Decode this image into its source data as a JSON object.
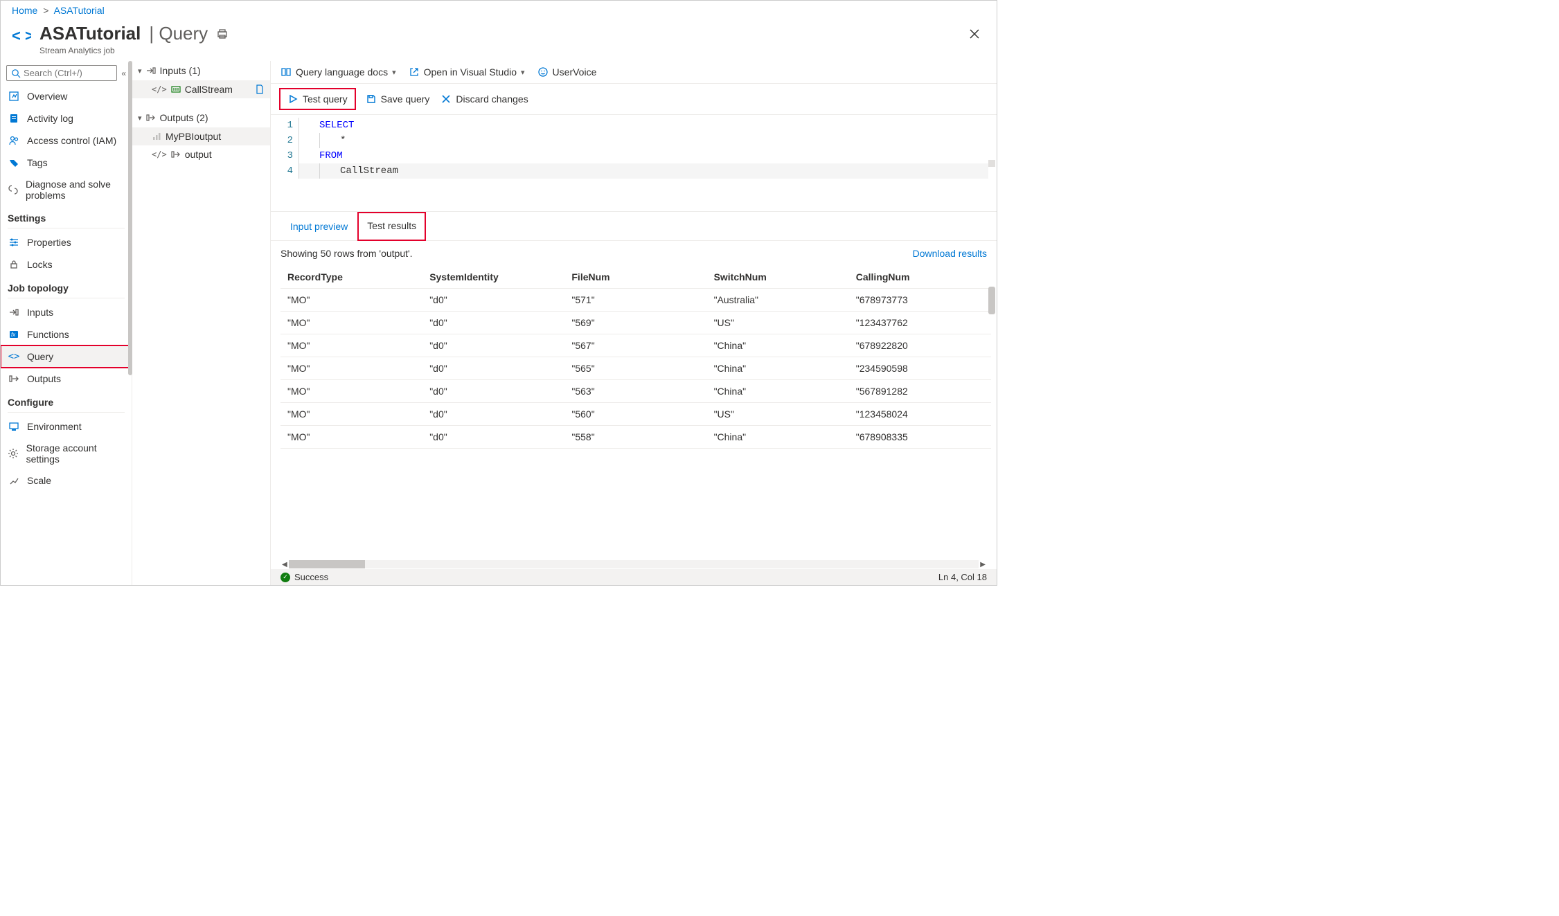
{
  "breadcrumb": {
    "home": "Home",
    "current": "ASATutorial"
  },
  "header": {
    "title_main": "ASATutorial",
    "title_suffix": "| Query",
    "subtitle": "Stream Analytics job"
  },
  "search": {
    "placeholder": "Search (Ctrl+/)"
  },
  "nav": {
    "overview": "Overview",
    "activity_log": "Activity log",
    "iam": "Access control (IAM)",
    "tags": "Tags",
    "diagnose": "Diagnose and solve problems",
    "section_settings": "Settings",
    "properties": "Properties",
    "locks": "Locks",
    "section_topology": "Job topology",
    "inputs": "Inputs",
    "functions": "Functions",
    "query": "Query",
    "outputs": "Outputs",
    "section_configure": "Configure",
    "environment": "Environment",
    "storage_settings": "Storage account settings",
    "scale": "Scale"
  },
  "tree": {
    "inputs_header": "Inputs (1)",
    "input_callstream": "CallStream",
    "outputs_header": "Outputs (2)",
    "output_pbi": "MyPBIoutput",
    "output_output": "output"
  },
  "top_toolbar": {
    "docs": "Query language docs",
    "open_vs": "Open in Visual Studio",
    "uservoice": "UserVoice"
  },
  "query_toolbar": {
    "test": "Test query",
    "save": "Save query",
    "discard": "Discard changes"
  },
  "editor": {
    "lines": [
      "1",
      "2",
      "3",
      "4"
    ],
    "kw_select": "SELECT",
    "star": "*",
    "kw_from": "FROM",
    "identifier": "CallStream"
  },
  "results": {
    "tab_preview": "Input preview",
    "tab_results": "Test results",
    "summary": "Showing 50 rows from 'output'.",
    "download": "Download results",
    "cols": {
      "c0": "RecordType",
      "c1": "SystemIdentity",
      "c2": "FileNum",
      "c3": "SwitchNum",
      "c4": "CallingNum"
    },
    "rows": [
      {
        "c0": "\"MO\"",
        "c1": "\"d0\"",
        "c2": "\"571\"",
        "c3": "\"Australia\"",
        "c4": "\"678973773"
      },
      {
        "c0": "\"MO\"",
        "c1": "\"d0\"",
        "c2": "\"569\"",
        "c3": "\"US\"",
        "c4": "\"123437762"
      },
      {
        "c0": "\"MO\"",
        "c1": "\"d0\"",
        "c2": "\"567\"",
        "c3": "\"China\"",
        "c4": "\"678922820"
      },
      {
        "c0": "\"MO\"",
        "c1": "\"d0\"",
        "c2": "\"565\"",
        "c3": "\"China\"",
        "c4": "\"234590598"
      },
      {
        "c0": "\"MO\"",
        "c1": "\"d0\"",
        "c2": "\"563\"",
        "c3": "\"China\"",
        "c4": "\"567891282"
      },
      {
        "c0": "\"MO\"",
        "c1": "\"d0\"",
        "c2": "\"560\"",
        "c3": "\"US\"",
        "c4": "\"123458024"
      },
      {
        "c0": "\"MO\"",
        "c1": "\"d0\"",
        "c2": "\"558\"",
        "c3": "\"China\"",
        "c4": "\"678908335"
      }
    ]
  },
  "status": {
    "text": "Success",
    "pos": "Ln 4, Col 18"
  }
}
